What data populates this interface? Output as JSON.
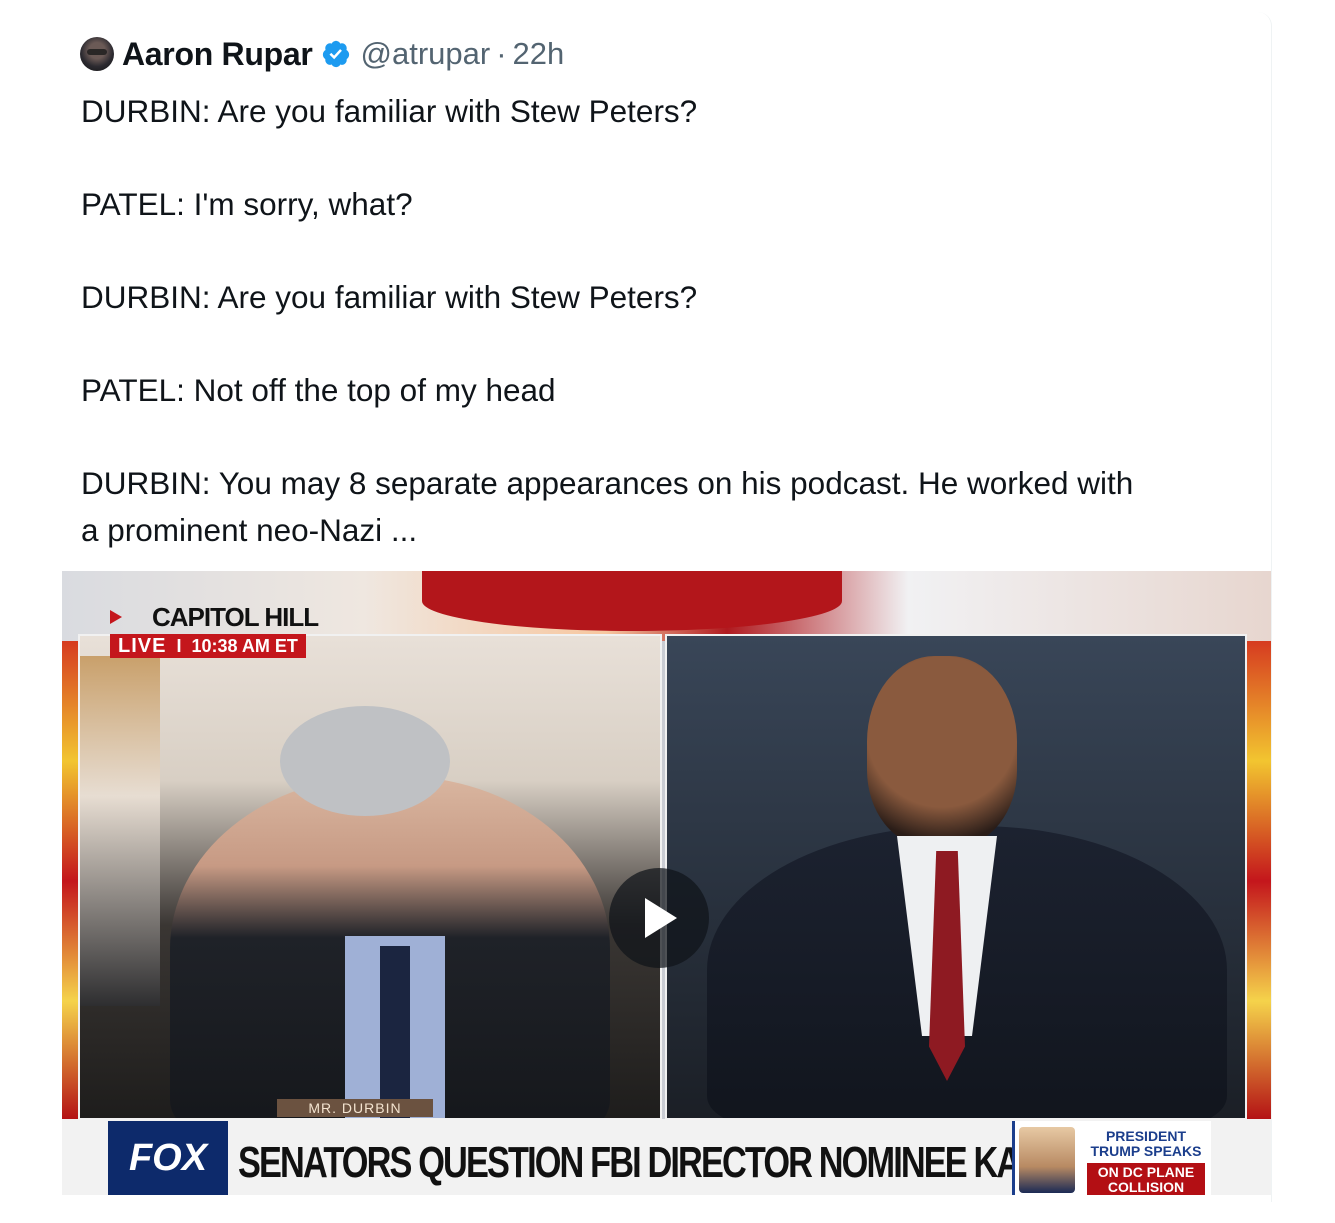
{
  "tweet": {
    "author_name": "Aaron Rupar",
    "handle": "@atrupar",
    "separator": "·",
    "time": "22h",
    "verified_icon": "verified-badge-icon",
    "text": "DURBIN: Are you familiar with Stew Peters?\n\nPATEL: I'm sorry, what?\n\nDURBIN: Are you familiar with Stew Peters?\n\nPATEL: Not off the top of my head\n\nDURBIN: You may 8 separate appearances on his podcast. He worked with\na prominent neo-Nazi ..."
  },
  "video": {
    "location": "CAPITOL HILL",
    "live_label": "LIVE",
    "live_separator": "I",
    "live_time": "10:38 AM ET",
    "nameplate": "MR. DURBIN",
    "network_logo": "FOX",
    "headline": "SENATORS QUESTION FBI DIRECTOR NOMINEE KASH PATEL",
    "side_promo_line1": "PRESIDENT TRUMP SPEAKS",
    "side_promo_line2": "ON DC PLANE COLLISION",
    "play_icon": "play-icon"
  },
  "colors": {
    "verified_blue": "#1d9bf0",
    "secondary_text": "#536471",
    "fox_red": "#c4161c",
    "fox_blue": "#0d2a6b"
  }
}
